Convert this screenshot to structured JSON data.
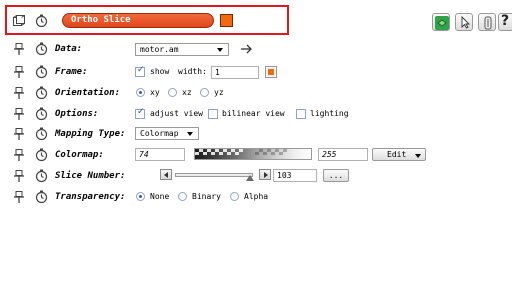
{
  "header": {
    "module_name": "Ortho Slice",
    "module_color": "#f26a10",
    "toolbar_icons": [
      "viewer-toggle-icon",
      "pointer-icon",
      "port-info-icon",
      "help-icon"
    ],
    "help_label": "?"
  },
  "ports": {
    "data": {
      "label": "Data:",
      "value": "motor.am",
      "link_icon": "arrow-right-icon"
    },
    "frame": {
      "label": "Frame:",
      "show_label": "show",
      "show_checked": true,
      "width_label": "width:",
      "width_value": "1",
      "color": "#f26a10"
    },
    "orientation": {
      "label": "Orientation:",
      "options": [
        "xy",
        "xz",
        "yz"
      ],
      "selected": "xy"
    },
    "options": {
      "label": "Options:",
      "items": [
        {
          "label": "adjust view",
          "checked": true
        },
        {
          "label": "bilinear view",
          "checked": false
        },
        {
          "label": "lighting",
          "checked": false
        }
      ]
    },
    "mapping_type": {
      "label": "Mapping Type:",
      "value": "Colormap"
    },
    "colormap": {
      "label": "Colormap:",
      "min_value": "74",
      "max_value": "255",
      "edit_label": "Edit"
    },
    "slice_number": {
      "label": "Slice Number:",
      "value": "103",
      "fraction": 0.94,
      "more_label": "..."
    },
    "transparency": {
      "label": "Transparency:",
      "options": [
        "None",
        "Binary",
        "Alpha"
      ],
      "selected": "None"
    }
  }
}
